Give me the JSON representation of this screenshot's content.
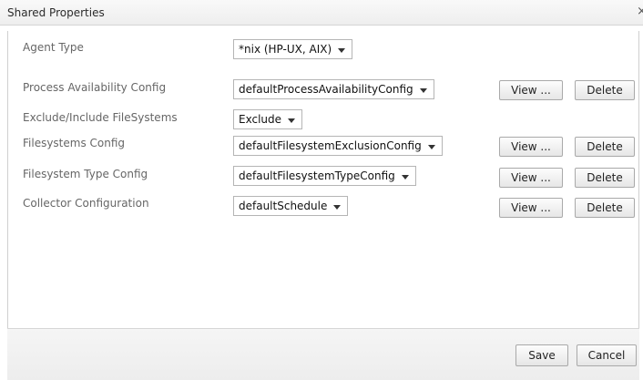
{
  "dialog": {
    "title": "Shared Properties",
    "close_glyph": "×"
  },
  "rows": [
    {
      "label": "Agent Type",
      "value": "*nix (HP-UX, AIX)"
    },
    {
      "label": "Process Availability Config",
      "value": "defaultProcessAvailabilityConfig",
      "view": "View ...",
      "delete": "Delete"
    },
    {
      "label": "Exclude/Include FileSystems",
      "value": "Exclude"
    },
    {
      "label": "Filesystems Config",
      "value": "defaultFilesystemExclusionConfig",
      "view": "View ...",
      "delete": "Delete"
    },
    {
      "label": "Filesystem Type Config",
      "value": "defaultFilesystemTypeConfig",
      "view": "View ...",
      "delete": "Delete"
    },
    {
      "label": "Collector Configuration",
      "value": "defaultSchedule",
      "view": "View ...",
      "delete": "Delete"
    }
  ],
  "footer": {
    "save_label": "Save",
    "cancel_label": "Cancel"
  }
}
